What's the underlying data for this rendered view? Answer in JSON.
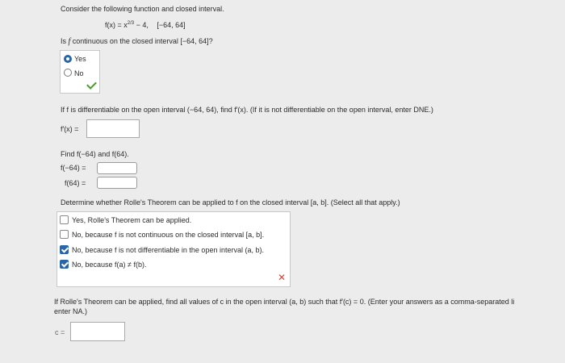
{
  "intro": "Consider the following function and closed interval.",
  "function_def": "f(x) = x^{2/3} − 4,",
  "function_lhs": "f(x) = x",
  "function_exp": "2/3",
  "function_rhs": " − 4,",
  "interval": "[−64, 64]",
  "q1": {
    "question_pre": "Is ",
    "question_f": "f",
    "question_post": " continuous on the closed interval [−64, 64]?",
    "options": [
      "Yes",
      "No"
    ],
    "selected": "Yes"
  },
  "q2": {
    "question": "If f is differentiable on the open interval (−64, 64), find f′(x). (If it is not differentiable on the open interval, enter DNE.)",
    "label": "f′(x) =",
    "value": ""
  },
  "q3": {
    "prompt": "Find f(−64) and f(64).",
    "label_a": "f(−64) =",
    "label_b": "f(64) =",
    "value_a": "",
    "value_b": ""
  },
  "q4": {
    "prompt": "Determine whether Rolle's Theorem can be applied to f on the closed interval [a, b]. (Select all that apply.)",
    "options": [
      {
        "label": "Yes, Rolle's Theorem can be applied.",
        "checked": false
      },
      {
        "label": "No, because f is not continuous on the closed interval [a, b].",
        "checked": false
      },
      {
        "label": "No, because f is not differentiable in the open interval (a, b).",
        "checked": true
      },
      {
        "label": "No, because f(a) ≠ f(b).",
        "checked": true
      }
    ]
  },
  "q5": {
    "prompt_line1": "If Rolle's Theorem can be applied, find all values of c in the open interval (a, b) such that f′(c) = 0. (Enter your answers as a comma-separated li",
    "prompt_line2": "enter NA.)",
    "label": "c =",
    "value": ""
  },
  "colors": {
    "accent": "#2966a8",
    "correct": "#4a9a2f",
    "incorrect": "#d9463c"
  }
}
